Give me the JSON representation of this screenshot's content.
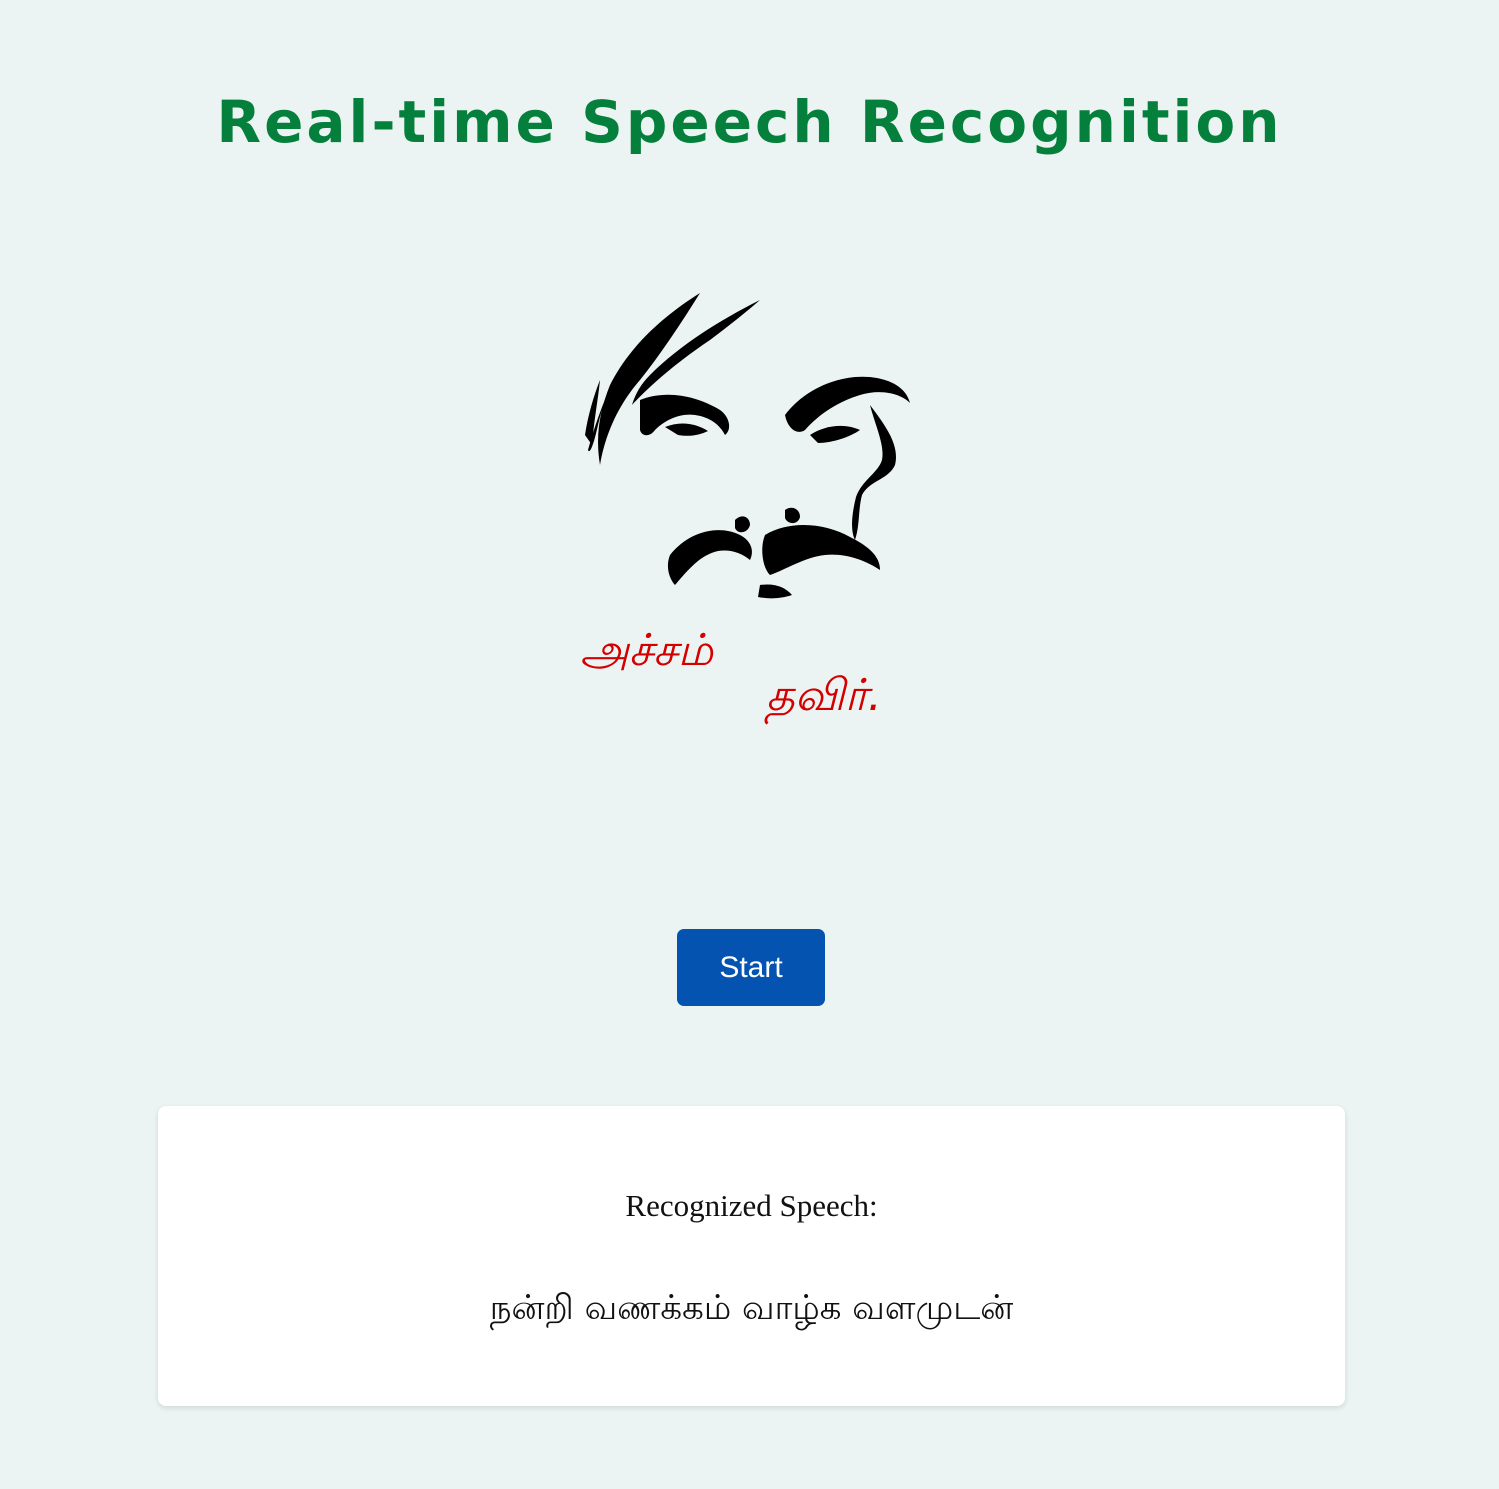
{
  "header": {
    "title": "Real-time Speech Recognition"
  },
  "logo": {
    "icon": "bharathiyar-portrait-logo",
    "tamil_line_1": "அச்சம்",
    "tamil_line_2": "தவிர்.",
    "text_color": "#d40000"
  },
  "controls": {
    "start_label": "Start"
  },
  "result": {
    "label": "Recognized Speech:",
    "text": "நன்றி வணக்கம் வாழ்க வளமுடன்"
  },
  "colors": {
    "background": "#ecf4f3",
    "title": "#05803c",
    "button": "#0553b0",
    "card": "#ffffff"
  }
}
